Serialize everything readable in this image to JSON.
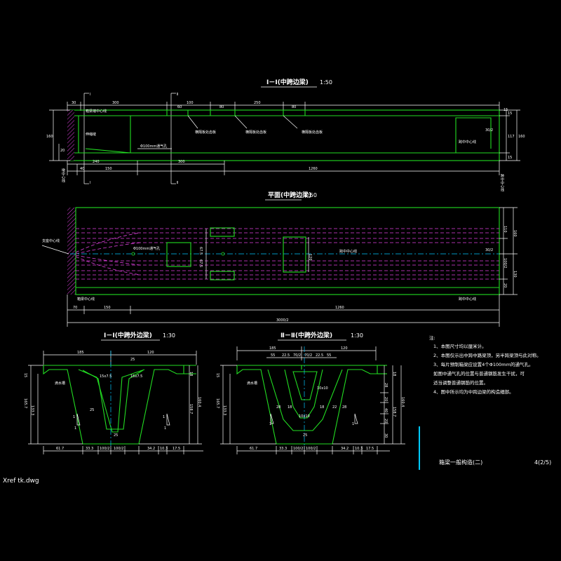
{
  "titles": {
    "elevation": "Ⅰ－Ⅰ(中跨边梁)",
    "elevation_scale": "1:50",
    "plan": "平面(中跨边梁)",
    "plan_scale": "1:50",
    "section1": "Ⅰ－Ⅰ(中跨外边梁)",
    "section1_scale": "1:30",
    "section2": "Ⅱ－Ⅱ(中跨外边梁)",
    "section2_scale": "1:30"
  },
  "elevation_dims_top": [
    "30",
    "300",
    "100",
    "60",
    "80",
    "250",
    "80",
    "15"
  ],
  "elevation_labels": {
    "plate1": "横隔板处齿板",
    "plate2": "横隔板处齿板",
    "plate3": "横隔板处齿板",
    "pipe": "Φ100mm通气孔",
    "left_a": "箱梁端中心线",
    "left_b": "伸缩缝",
    "right_a": "跨中中心线",
    "ratio": "30/2"
  },
  "elevation_dims_bottom": [
    "40",
    "240",
    "150",
    "300",
    "1260"
  ],
  "elevation_right_dims": [
    "15",
    "117",
    "15",
    "160"
  ],
  "elevation_left_dims": [
    "160",
    "20"
  ],
  "section_marks": [
    "Ⅰ",
    "Ⅰ",
    "Ⅱ",
    "Ⅱ"
  ],
  "plan_labels": {
    "left": "支座中心线",
    "pipe": "Φ100mm通气孔",
    "center": "跨中中心线",
    "end_left": "箱梁中心线",
    "end_right": "跨中中心线",
    "ratio": "30/2",
    "pier_left": "墩中心线",
    "pier_right": "跨中中心线"
  },
  "plan_dims_bottom": [
    "70",
    "150",
    "1260",
    "3000/2"
  ],
  "plan_right_dims": [
    "110",
    "160",
    "100/2",
    "20",
    "130"
  ],
  "plan_inner_dims": [
    "67.5",
    "67.5",
    "120"
  ],
  "sec1_dims_top": [
    "185",
    "120",
    "25"
  ],
  "sec1_dims_bottom": [
    "61.7",
    "33.3",
    "100/2",
    "100/2",
    "34.2",
    "10.3",
    "17.5"
  ],
  "sec1_dims_left": [
    "15",
    "165.7",
    "133.3"
  ],
  "sec1_dims_right": [
    "18",
    "158.7",
    "160.4"
  ],
  "sec1_labels": {
    "drip": "滴水槽",
    "haunch_l": "15x7.5",
    "haunch_r": "15x7.5",
    "web": "25",
    "bottom": "25",
    "mark1": "1",
    "mark2": "1",
    "mark3": "1",
    "mark4": "1"
  },
  "sec2_dims_top": [
    "185",
    "120",
    "55",
    "22.5",
    "70/2",
    "70/2",
    "22.5",
    "55"
  ],
  "sec2_dims_bottom": [
    "61.7",
    "33.3",
    "100/2",
    "100/2",
    "34.2",
    "10.3",
    "17.5"
  ],
  "sec2_dims_left": [
    "15",
    "165.7",
    "133.3"
  ],
  "sec2_dims_right": [
    "18",
    "158.7",
    "160.4",
    "28",
    "20",
    "40",
    "20",
    "30"
  ],
  "sec2_labels": {
    "drip": "滴水槽",
    "haunch": "10x10",
    "haunch2": "10x10",
    "w1": "28",
    "w2": "18",
    "w3": "28",
    "w4": "22",
    "w5": "18",
    "w6": "25",
    "mark1": "1",
    "mark2": "1"
  },
  "notes": {
    "heading": "注:",
    "items": [
      "1、本图尺寸均以厘米计。",
      "2、本图仅示出中跨中路梁顶，另半跨梁顶与此对称。",
      "3、每片预制箱梁应设置4个Φ100mm的通气孔。",
      "   如图中通气孔的位置与普通钢筋发生干扰，可",
      "   适当调整普通钢筋的位置。",
      "4、图中所示均为中跨边梁的构造细部。"
    ]
  },
  "title_block": {
    "title": "箱梁一般构造(二)",
    "sheet": "4(2/5)"
  },
  "file_label": "Xref tk.dwg",
  "colors": {
    "background": "#000000",
    "outline": "#22dd22",
    "tendon": "#e040e0",
    "dimension": "#ffffff",
    "center": "#00c8ff"
  }
}
